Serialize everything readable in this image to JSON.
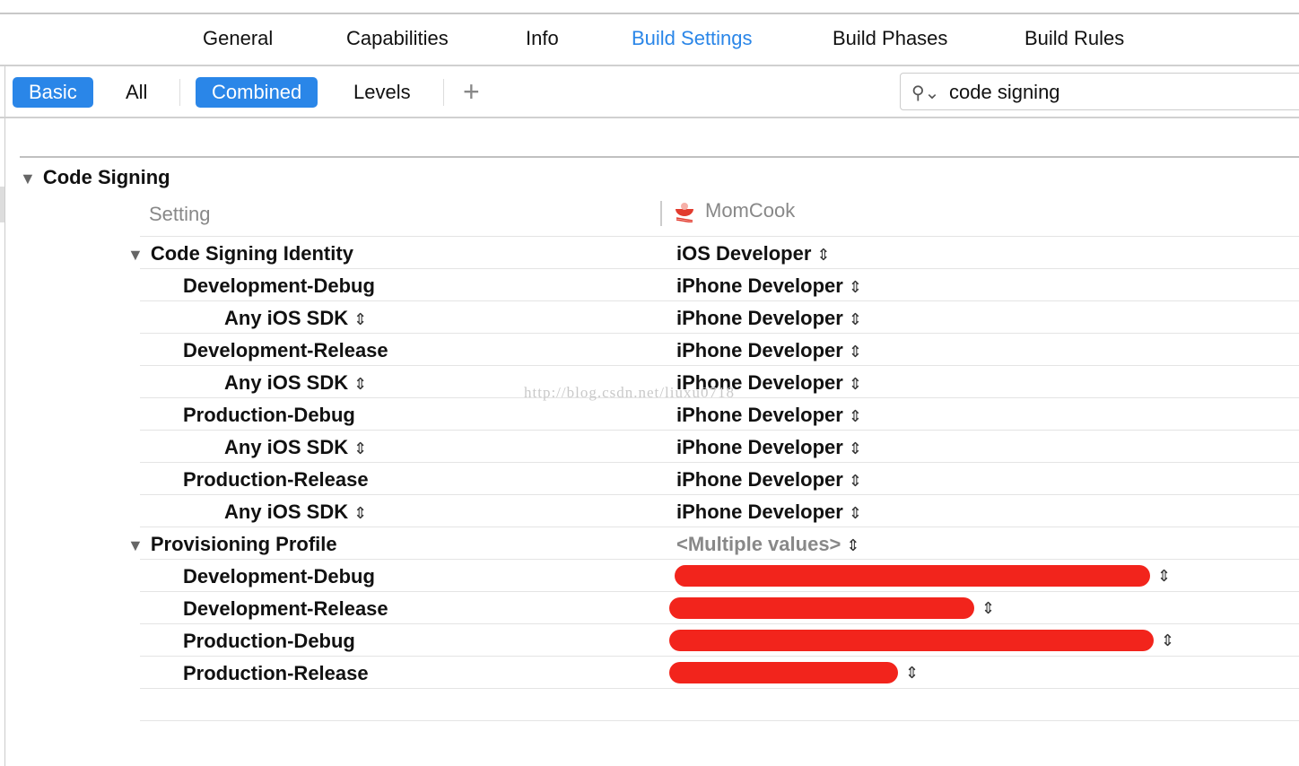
{
  "tabs": [
    "General",
    "Capabilities",
    "Info",
    "Build Settings",
    "Build Phases",
    "Build Rules"
  ],
  "active_tab": "Build Settings",
  "filters": {
    "basic": "Basic",
    "all": "All",
    "combined": "Combined",
    "levels": "Levels",
    "add": "+"
  },
  "search": {
    "value": "code signing"
  },
  "section": {
    "title": "Code Signing",
    "setting_header": "Setting",
    "target": "MomCook"
  },
  "rows": [
    {
      "name": "Code Signing Identity",
      "level": 0,
      "value": "iOS Developer"
    },
    {
      "name": "Development-Debug",
      "level": 1,
      "value": "iPhone Developer"
    },
    {
      "name": "Any iOS SDK",
      "level": 2,
      "value": "iPhone Developer",
      "stepper": true
    },
    {
      "name": "Development-Release",
      "level": 1,
      "value": "iPhone Developer"
    },
    {
      "name": "Any iOS SDK",
      "level": 2,
      "value": "iPhone Developer",
      "stepper": true
    },
    {
      "name": "Production-Debug",
      "level": 1,
      "value": "iPhone Developer"
    },
    {
      "name": "Any iOS SDK",
      "level": 2,
      "value": "iPhone Developer",
      "stepper": true
    },
    {
      "name": "Production-Release",
      "level": 1,
      "value": "iPhone Developer"
    },
    {
      "name": "Any iOS SDK",
      "level": 2,
      "value": "iPhone Developer",
      "stepper": true
    },
    {
      "name": "Provisioning Profile",
      "level": 0,
      "value": "<Multiple values>",
      "muted": true
    },
    {
      "name": "Development-Debug",
      "level": 1,
      "value": "",
      "redacted": true
    },
    {
      "name": "Development-Release",
      "level": 1,
      "value": "",
      "redacted": true
    },
    {
      "name": "Production-Debug",
      "level": 1,
      "value": "",
      "redacted": true
    },
    {
      "name": "Production-Release",
      "level": 1,
      "value": "",
      "redacted": true
    }
  ],
  "watermark": "http://blog.csdn.net/liuxu0718",
  "colors": {
    "accent": "#2a86e8",
    "redaction": "#f2241c"
  }
}
